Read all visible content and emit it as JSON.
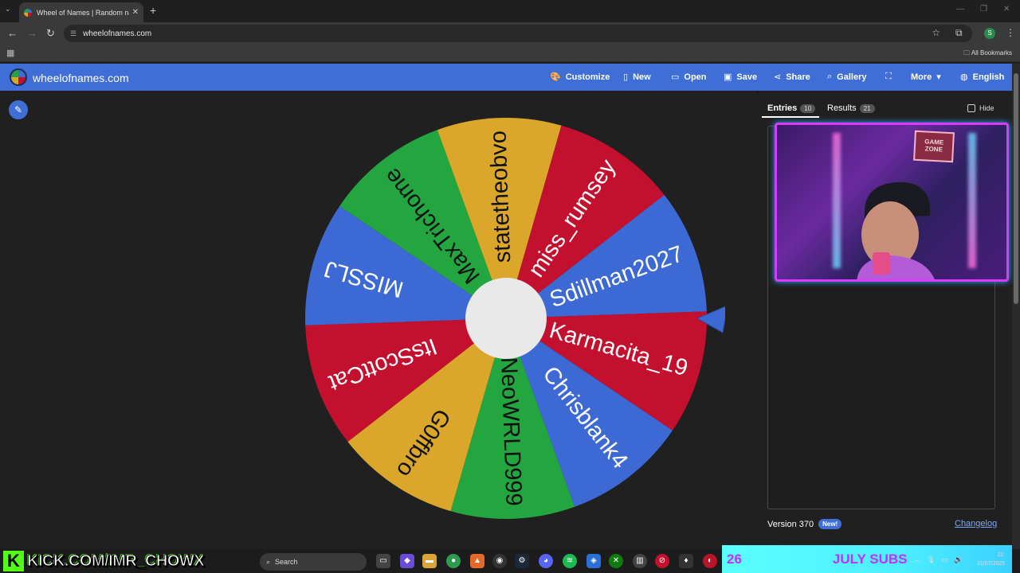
{
  "browser": {
    "tab_title": "Wheel of Names | Random nam",
    "url": "wheelofnames.com",
    "all_bookmarks": "All Bookmarks",
    "profile_initial": "S"
  },
  "header": {
    "logo_text": "wheelofnames.com",
    "buttons": [
      {
        "label": "Customize",
        "icon": "palette-icon"
      },
      {
        "label": "New",
        "icon": "file-icon"
      },
      {
        "label": "Open",
        "icon": "folder-open-icon"
      },
      {
        "label": "Save",
        "icon": "save-icon"
      },
      {
        "label": "Share",
        "icon": "share-icon"
      },
      {
        "label": "Gallery",
        "icon": "search-icon"
      },
      {
        "label": "",
        "icon": "fullscreen-icon"
      },
      {
        "label": "More",
        "icon": "chevron-down-icon"
      },
      {
        "label": "English",
        "icon": "globe-icon"
      }
    ]
  },
  "wheel": {
    "segments": [
      {
        "name": "Sdillman2027",
        "color": "#3d69d4"
      },
      {
        "name": "Karmacita_19",
        "color": "#c4102f"
      },
      {
        "name": "Chrisblank4",
        "color": "#3d69d4"
      },
      {
        "name": "NeoWRLD999",
        "color": "#23a63f"
      },
      {
        "name": "G0ffbro",
        "color": "#dba72a"
      },
      {
        "name": "ItsScottCat",
        "color": "#c4102f"
      },
      {
        "name": "MISSLJ",
        "color": "#3d69d4"
      },
      {
        "name": "MaxTrichome",
        "color": "#23a63f"
      },
      {
        "name": "statetheobvo",
        "color": "#dba72a"
      },
      {
        "name": "miss_rumsey",
        "color": "#c4102f"
      }
    ],
    "pointer_color": "#3d69d4"
  },
  "panel": {
    "entries_label": "Entries",
    "entries_count": "10",
    "results_label": "Results",
    "results_count": "21",
    "hide_label": "Hide",
    "version": "Version 370",
    "new_badge": "New!",
    "changelog": "Changelog"
  },
  "overlay": {
    "cam_sign": "GAME ZONE",
    "kick_url": "KICK.COM/IMR_CHOWX",
    "subs_count": "26",
    "subs_label": "JULY SUBS"
  },
  "taskbar": {
    "search_placeholder": "Search",
    "time": "22:",
    "date": "31/07/2025"
  }
}
